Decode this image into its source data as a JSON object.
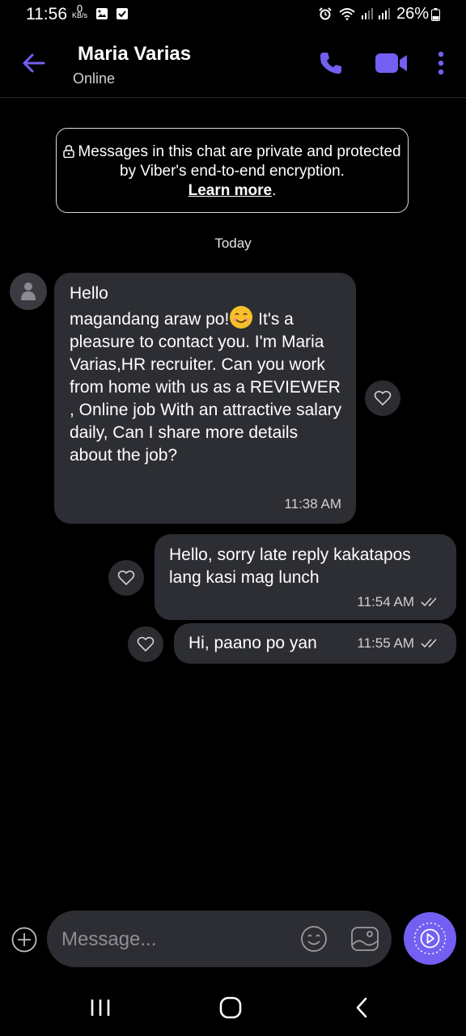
{
  "status_bar": {
    "time": "11:56",
    "data_rate_value": "0",
    "data_rate_unit": "KB/s",
    "battery": "26%"
  },
  "header": {
    "contact_name": "Maria Varias",
    "contact_status": "Online",
    "accent_color": "#7360f2"
  },
  "notice": {
    "text": "Messages in this chat are private and protected by Viber's end-to-end encryption.",
    "link": "Learn more",
    "suffix": "."
  },
  "date_divider": "Today",
  "messages": [
    {
      "direction": "incoming",
      "line1": "Hello",
      "line2_before_emoji": "magandang araw po!",
      "emoji": "smiling-face-icon",
      "line2_after_emoji": " It's a pleasure to contact you. I'm Maria Varias,HR recruiter. Can you work from home with us as a REVIEWER , Online job With an attractive salary daily, Can I share more details about the job?",
      "time": "11:38 AM"
    },
    {
      "direction": "outgoing",
      "text": "Hello, sorry late reply kakatapos lang kasi mag lunch",
      "time": "11:54 AM"
    },
    {
      "direction": "outgoing",
      "text": "Hi, paano po yan",
      "time": "11:55 AM"
    }
  ],
  "composer": {
    "placeholder": "Message..."
  }
}
